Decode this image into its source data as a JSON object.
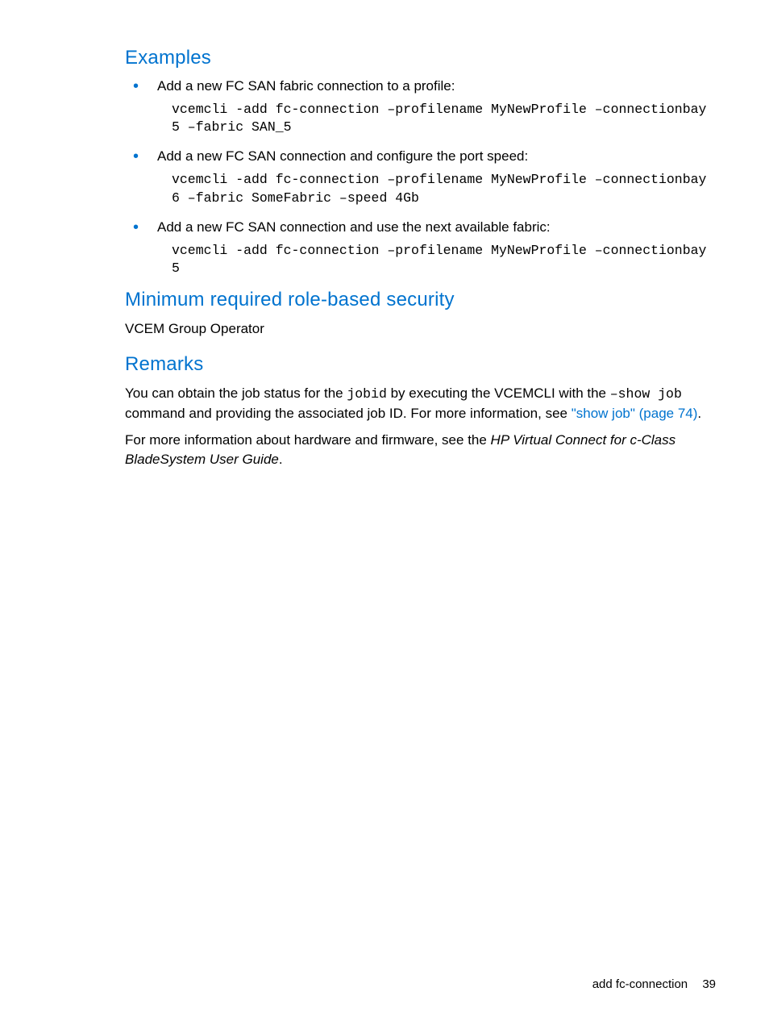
{
  "sections": {
    "examples": {
      "heading": "Examples",
      "items": [
        {
          "desc": "Add a new FC SAN fabric connection to a profile:",
          "code": "vcemcli -add fc-connection –profilename MyNewProfile –connectionbay 5 –fabric SAN_5"
        },
        {
          "desc": "Add a new FC SAN connection and configure the port speed:",
          "code": "vcemcli -add fc-connection –profilename MyNewProfile –connectionbay 6 –fabric SomeFabric –speed 4Gb"
        },
        {
          "desc": "Add a new FC SAN connection and use the next available fabric:",
          "code": "vcemcli -add fc-connection –profilename MyNewProfile –connectionbay 5"
        }
      ]
    },
    "security": {
      "heading": "Minimum required role-based security",
      "text": "VCEM Group Operator"
    },
    "remarks": {
      "heading": "Remarks",
      "p1_pre": "You can obtain the job status for the ",
      "p1_code1": "jobid",
      "p1_mid": " by executing the VCEMCLI with the ",
      "p1_code2": "–show job",
      "p1_mid2": " command and providing the associated job ID. For more information, see ",
      "p1_link": "\"show job\" (page 74)",
      "p1_post": ".",
      "p2_pre": "For more information about hardware and firmware, see the ",
      "p2_italic": "HP Virtual Connect for c-Class BladeSystem User Guide",
      "p2_post": "."
    }
  },
  "footer": {
    "section": "add fc-connection",
    "page": "39"
  }
}
